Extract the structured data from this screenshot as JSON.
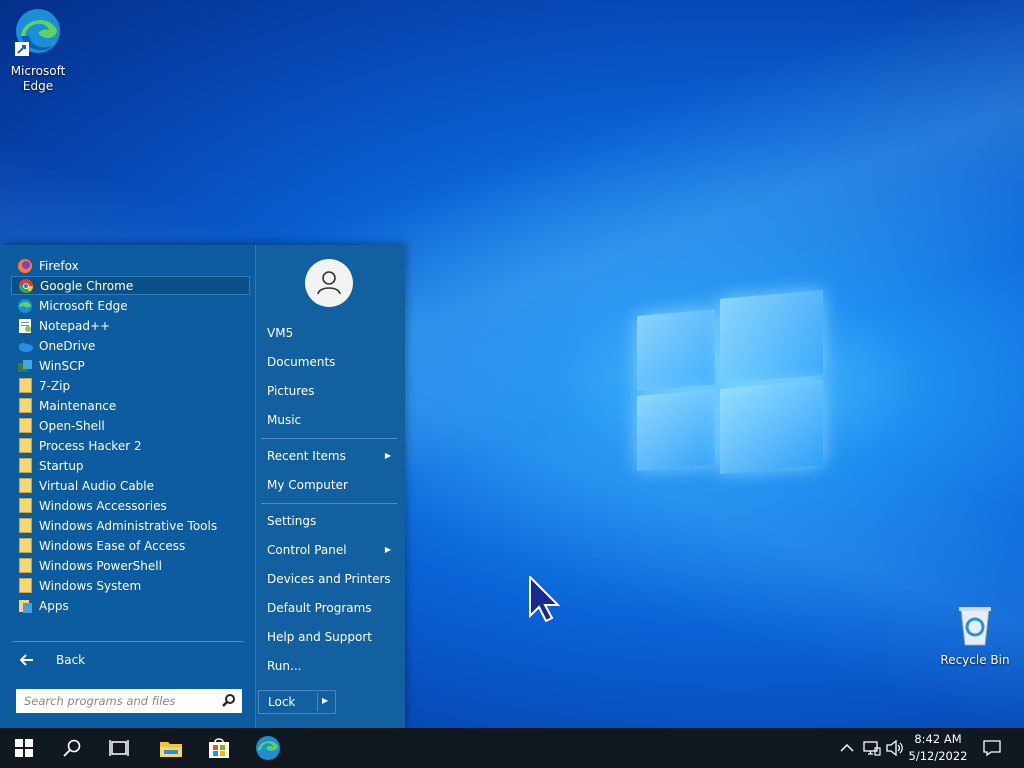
{
  "desktop": {
    "icons": [
      {
        "label": "Microsoft Edge",
        "icon": "edge-icon"
      },
      {
        "label": "Recycle Bin",
        "icon": "recycle-bin-icon"
      }
    ]
  },
  "start_menu": {
    "programs": [
      {
        "label": "Firefox",
        "icon": "firefox-icon"
      },
      {
        "label": "Google Chrome",
        "icon": "chrome-icon",
        "selected": true
      },
      {
        "label": "Microsoft Edge",
        "icon": "edge-icon"
      },
      {
        "label": "Notepad++",
        "icon": "notepad-plus-plus-icon"
      },
      {
        "label": "OneDrive",
        "icon": "onedrive-icon"
      },
      {
        "label": "WinSCP",
        "icon": "winscp-icon"
      },
      {
        "label": "7-Zip",
        "icon": "folder-icon"
      },
      {
        "label": "Maintenance",
        "icon": "folder-icon"
      },
      {
        "label": "Open-Shell",
        "icon": "folder-icon"
      },
      {
        "label": "Process Hacker 2",
        "icon": "folder-icon"
      },
      {
        "label": "Startup",
        "icon": "folder-icon"
      },
      {
        "label": "Virtual Audio Cable",
        "icon": "folder-icon"
      },
      {
        "label": "Windows Accessories",
        "icon": "folder-icon"
      },
      {
        "label": "Windows Administrative Tools",
        "icon": "folder-icon"
      },
      {
        "label": "Windows Ease of Access",
        "icon": "folder-icon"
      },
      {
        "label": "Windows PowerShell",
        "icon": "folder-icon"
      },
      {
        "label": "Windows System",
        "icon": "folder-icon"
      },
      {
        "label": "Apps",
        "icon": "apps-icon"
      }
    ],
    "back_label": "Back",
    "search_placeholder": "Search programs and files",
    "right_items": [
      {
        "label": "VM5"
      },
      {
        "label": "Documents"
      },
      {
        "label": "Pictures"
      },
      {
        "label": "Music"
      },
      {
        "label": "Recent Items",
        "submenu": true
      },
      {
        "label": "My Computer"
      },
      {
        "label": "Settings"
      },
      {
        "label": "Control Panel",
        "submenu": true
      },
      {
        "label": "Devices and Printers"
      },
      {
        "label": "Default Programs"
      },
      {
        "label": "Help and Support"
      },
      {
        "label": "Run..."
      }
    ],
    "lock_label": "Lock"
  },
  "taskbar": {
    "time": "8:42 AM",
    "date": "5/12/2022"
  }
}
